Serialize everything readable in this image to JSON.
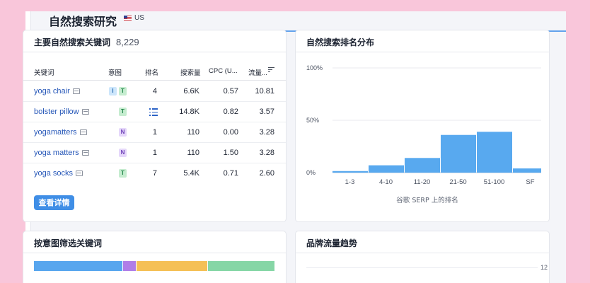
{
  "header": {
    "title": "自然搜索研究",
    "database": "US"
  },
  "keywords_card": {
    "title": "主要自然搜索关键词",
    "count": "8,229",
    "columns": {
      "keyword": "关键词",
      "intent": "意图",
      "position": "排名",
      "volume": "搜索量",
      "cpc": "CPC (U...",
      "traffic": "流量..."
    },
    "rows": [
      {
        "keyword": "yoga chair",
        "intents": [
          "I",
          "T"
        ],
        "position": "4",
        "volume": "6.6K",
        "cpc": "0.57",
        "traffic": "10.81"
      },
      {
        "keyword": "bolster pillow",
        "intents": [
          "T"
        ],
        "position": "",
        "serp_feature_icon": "list-icon",
        "volume": "14.8K",
        "cpc": "0.82",
        "traffic": "3.57"
      },
      {
        "keyword": "yogamatters",
        "intents": [
          "N"
        ],
        "position": "1",
        "volume": "110",
        "cpc": "0.00",
        "traffic": "3.28"
      },
      {
        "keyword": "yoga matters",
        "intents": [
          "N"
        ],
        "position": "1",
        "volume": "110",
        "cpc": "1.50",
        "traffic": "3.28"
      },
      {
        "keyword": "yoga socks",
        "intents": [
          "T"
        ],
        "position": "7",
        "volume": "5.4K",
        "cpc": "0.71",
        "traffic": "2.60"
      }
    ],
    "details_button": "查看详情"
  },
  "distribution_card": {
    "title": "自然搜索排名分布"
  },
  "intent_card": {
    "title": "按意图筛选关键词",
    "segments": [
      {
        "share": 0.37,
        "color": "#58a6ee"
      },
      {
        "share": 0.055,
        "color": "#b07ee8"
      },
      {
        "share": 0.295,
        "color": "#f5c056"
      },
      {
        "share": 0.28,
        "color": "#86d6a6"
      }
    ]
  },
  "brand_card": {
    "title": "品牌流量趋势",
    "axis_label": "12"
  },
  "colors": {
    "accent": "#3f8ee6",
    "bar": "#58a9ef",
    "link": "#2657b8"
  },
  "chart_data": {
    "type": "bar",
    "title": "",
    "categories": [
      "1-3",
      "4-10",
      "11-20",
      "21-50",
      "51-100",
      "SF"
    ],
    "values": [
      1.5,
      7,
      14,
      36,
      39,
      4
    ],
    "xlabel": "谷歌 SERP 上的排名",
    "ylabel": "",
    "yticks": [
      "0%",
      "50%",
      "100%"
    ],
    "ylim": [
      0,
      100
    ],
    "grid": true
  }
}
